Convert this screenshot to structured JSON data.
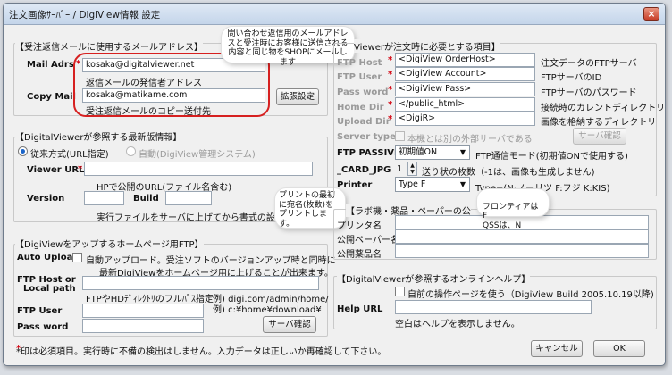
{
  "window": {
    "title": "注文画像ｻｰﾊﾞｰ / DigiView情報 設定",
    "close_label": "×"
  },
  "mail": {
    "section_title": "【受注返信メールに使用するメールアドレス】",
    "mail_adrs_label": "Mail Adrs",
    "mail_adrs_value": "kosaka@digitalviewer.net",
    "mail_adrs_note": "返信メールの発信者アドレス",
    "copy_mail_label": "Copy Mail",
    "copy_mail_value": "kosaka@matikame.com",
    "copy_mail_note": "受注返信メールのコピー送付先",
    "ext_button": "拡張設定"
  },
  "callouts": {
    "mail": "問い合わせ返信用のメールアドレスと受注時にお客様に送信される内容と同じ物をSHOPにメールします",
    "print": "プリントの最初に宛名(枚数)をプリントします。",
    "frontier": "フロンティアは F\nQSSは、N"
  },
  "digiview": {
    "section_title": "【DigitalViewerが参照する最新版情報】",
    "radio_conventional": "従来方式(URL指定)",
    "radio_auto": "自動(DigiView管理システム)",
    "viewer_url_label": "Viewer URL",
    "viewer_url_value": "",
    "viewer_url_note": "HPで公開のURL(ファイル名含む)",
    "version_label": "Version",
    "version_value": "",
    "build_label": "Build",
    "build_value": "",
    "note": "実行ファイルをサーバに上げてから書式の設定を送信して"
  },
  "ftp": {
    "section_title": "【DigiViewをアップするホームページ用FTP】",
    "auto_upload_label": "Auto Upload",
    "auto_upload_text1": "自動アップロード。受注ソフトのバージョンアップ時と同時に",
    "auto_upload_text2": "最新DigiViewをホームページ用に上げることが出来ます。",
    "host_label1": "FTP Host or",
    "host_label2": "Local path",
    "host_value": "",
    "host_note": "FTPやHDﾃﾞｨﾚｸﾄﾘのフルﾊﾟｽ指定",
    "example1": "例) digi.com/admin/home/",
    "example2": "例) c:¥home¥download¥",
    "user_label": "FTP User",
    "user_value": "",
    "pass_label": "Pass word",
    "pass_value": "",
    "confirm_button": "サーバ確認"
  },
  "order": {
    "section_title": "Viewerが注文時に必要とする項目】",
    "rows": [
      {
        "label": "FTP Host",
        "value": "<DigiView OrderHost>",
        "note": "注文データのFTPサーバ"
      },
      {
        "label": "FTP User",
        "value": "<DigiView Account>",
        "note": "FTPサーバのID"
      },
      {
        "label": "Pass word",
        "value": "<DigiView Pass>",
        "note": "FTPサーバのパスワード"
      },
      {
        "label": "Home Dir",
        "value": "</public_html>",
        "note": "接続時のカレントディレクトリ"
      },
      {
        "label": "Upload Dir",
        "value": "<DigiR>",
        "note": "画像を格納するディレクトリ"
      }
    ],
    "server_type_label": "Server type",
    "server_type_text": "本機とは別の外部サーバである",
    "server_confirm_button": "サーバ確認",
    "passive_label": "FTP PASSIVE",
    "passive_value": "初期値ON",
    "passive_note": "FTP通信モード(初期値ONで使用する)",
    "card_label": "_CARD_JPG",
    "card_value": "1",
    "card_note": "送り状の枚数（-1は、画像も生成しません)",
    "printer_label": "Printer",
    "printer_value": "Type F",
    "printer_note": "Type=(N:ノーリツ F:フジ K:KIS)"
  },
  "lab": {
    "section_title": "【ラボ機・薬品・ペーパーの公",
    "printer_name_label": "プリンタ名",
    "paper_name_label": "公開ペーパー名",
    "chem_name_label": "公開薬品名"
  },
  "help": {
    "section_title": "【DigitalViewerが参照するオンラインヘルプ】",
    "checkbox_text": "自前の操作ページを使う（DigiView Build 2005.10.19以降)",
    "url_label": "Help URL",
    "url_value": "",
    "note": "空白はヘルプを表示しません。"
  },
  "footer": {
    "note": "*印は必須項目。実行時に不備の検出はしません。入力データは正しいか再確認して下さい。",
    "cancel_button": "キャンセル",
    "ok_button": "OK"
  }
}
